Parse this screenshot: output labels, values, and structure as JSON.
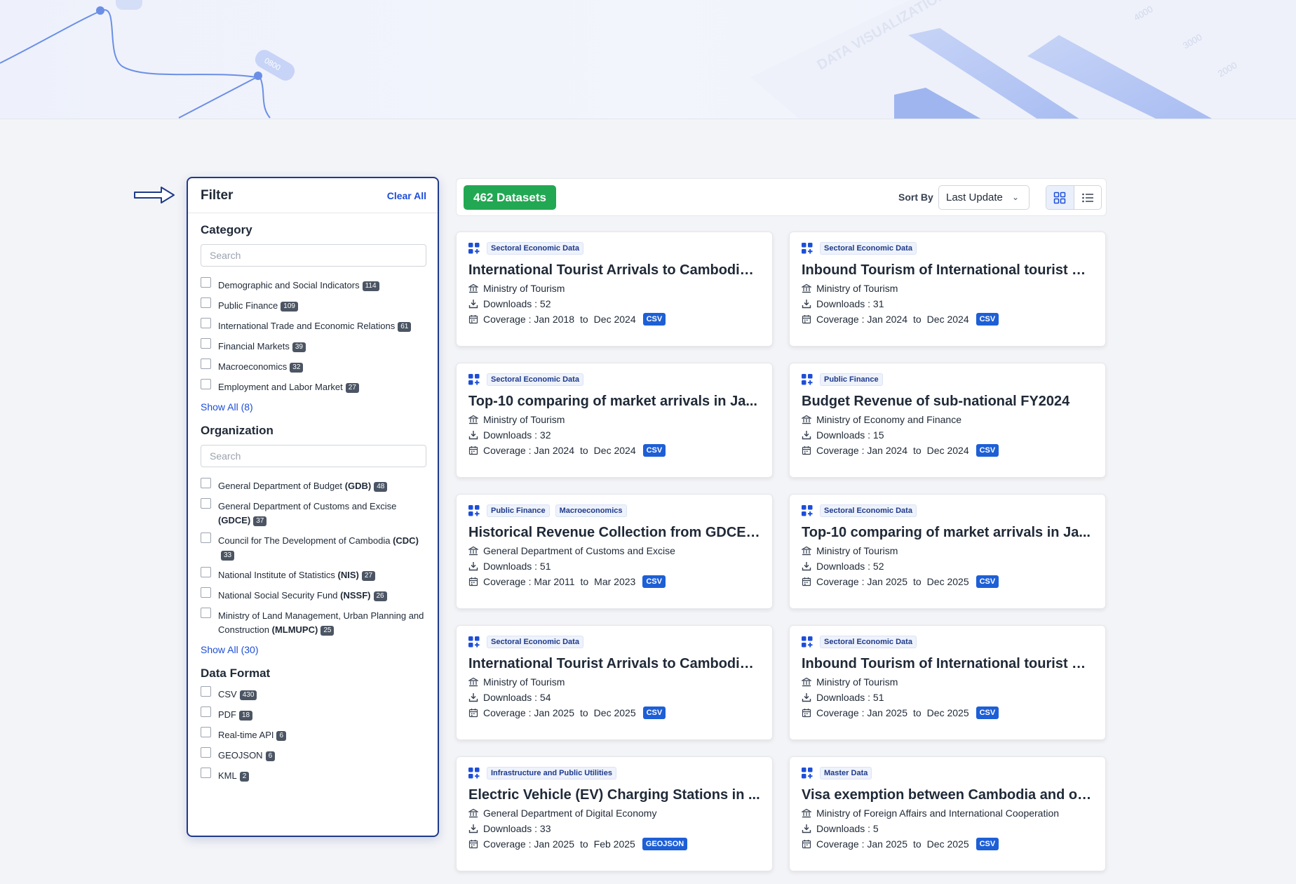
{
  "hero": {
    "marker_1": "0800"
  },
  "filter": {
    "title": "Filter",
    "clear_all": "Clear All",
    "category": {
      "title": "Category",
      "search_placeholder": "Search",
      "items": [
        {
          "label": "Demographic and Social Indicators",
          "count": "114"
        },
        {
          "label": "Public Finance",
          "count": "109"
        },
        {
          "label": "International Trade and Economic Relations",
          "count": "61"
        },
        {
          "label": "Financial Markets",
          "count": "39"
        },
        {
          "label": "Macroeconomics",
          "count": "32"
        },
        {
          "label": "Employment and Labor Market",
          "count": "27"
        }
      ],
      "show_all": "Show All (8)"
    },
    "organization": {
      "title": "Organization",
      "search_placeholder": "Search",
      "items": [
        {
          "label": "General Department of Budget",
          "abbr": "(GDB)",
          "count": "48"
        },
        {
          "label": "General Department of Customs and Excise",
          "abbr": "(GDCE)",
          "count": "37"
        },
        {
          "label": "Council for The Development of Cambodia",
          "abbr": "(CDC)",
          "count": "33"
        },
        {
          "label": "National Institute of Statistics",
          "abbr": "(NIS)",
          "count": "27"
        },
        {
          "label": "National Social Security Fund",
          "abbr": "(NSSF)",
          "count": "26"
        },
        {
          "label": "Ministry of Land Management, Urban Planning and Construction",
          "abbr": "(MLMUPC)",
          "count": "25"
        }
      ],
      "show_all": "Show All (30)"
    },
    "data_format": {
      "title": "Data Format",
      "items": [
        {
          "label": "CSV",
          "count": "430"
        },
        {
          "label": "PDF",
          "count": "18"
        },
        {
          "label": "Real-time API",
          "count": "6"
        },
        {
          "label": "GEOJSON",
          "count": "6"
        },
        {
          "label": "KML",
          "count": "2"
        }
      ]
    }
  },
  "results": {
    "count_label": "462 Datasets",
    "sort_by_label": "Sort By",
    "sort_value": "Last Update"
  },
  "labels": {
    "downloads": "Downloads : ",
    "coverage": "Coverage : ",
    "to": "to"
  },
  "cards": [
    {
      "tags": [
        "Sectoral Economic Data"
      ],
      "title": "International Tourist Arrivals to Cambodia ...",
      "org": "Ministry of Tourism",
      "downloads": "52",
      "from": "Jan 2018",
      "to": "Dec 2024",
      "format": "CSV"
    },
    {
      "tags": [
        "Sectoral Economic Data"
      ],
      "title": "Inbound Tourism of International tourist ar...",
      "org": "Ministry of Tourism",
      "downloads": "31",
      "from": "Jan 2024",
      "to": "Dec 2024",
      "format": "CSV"
    },
    {
      "tags": [
        "Sectoral Economic Data"
      ],
      "title": "Top-10 comparing of market arrivals in Ja...",
      "org": "Ministry of Tourism",
      "downloads": "32",
      "from": "Jan 2024",
      "to": "Dec 2024",
      "format": "CSV"
    },
    {
      "tags": [
        "Public Finance"
      ],
      "title": "Budget Revenue of sub-national FY2024",
      "org": "Ministry of Economy and Finance",
      "downloads": "15",
      "from": "Jan 2024",
      "to": "Dec 2024",
      "format": "CSV"
    },
    {
      "tags": [
        "Public Finance",
        "Macroeconomics"
      ],
      "title": "Historical Revenue Collection from GDCE a...",
      "org": "General Department of Customs and Excise",
      "downloads": "51",
      "from": "Mar 2011",
      "to": "Mar 2023",
      "format": "CSV"
    },
    {
      "tags": [
        "Sectoral Economic Data"
      ],
      "title": "Top-10 comparing of market arrivals in Ja...",
      "org": "Ministry of Tourism",
      "downloads": "52",
      "from": "Jan 2025",
      "to": "Dec 2025",
      "format": "CSV"
    },
    {
      "tags": [
        "Sectoral Economic Data"
      ],
      "title": "International Tourist Arrivals to Cambodia ...",
      "org": "Ministry of Tourism",
      "downloads": "54",
      "from": "Jan 2025",
      "to": "Dec 2025",
      "format": "CSV"
    },
    {
      "tags": [
        "Sectoral Economic Data"
      ],
      "title": "Inbound Tourism of International tourist ar...",
      "org": "Ministry of Tourism",
      "downloads": "51",
      "from": "Jan 2025",
      "to": "Dec 2025",
      "format": "CSV"
    },
    {
      "tags": [
        "Infrastructure and Public Utilities"
      ],
      "title": "Electric Vehicle (EV) Charging Stations in ...",
      "org": "General Department of Digital Economy",
      "downloads": "33",
      "from": "Jan 2025",
      "to": "Feb 2025",
      "format": "GEOJSON"
    },
    {
      "tags": [
        "Master Data"
      ],
      "title": "Visa exemption between Cambodia and ot...",
      "org": "Ministry of Foreign Affairs and International Cooperation",
      "downloads": "5",
      "from": "Jan 2025",
      "to": "Dec 2025",
      "format": "CSV"
    }
  ]
}
